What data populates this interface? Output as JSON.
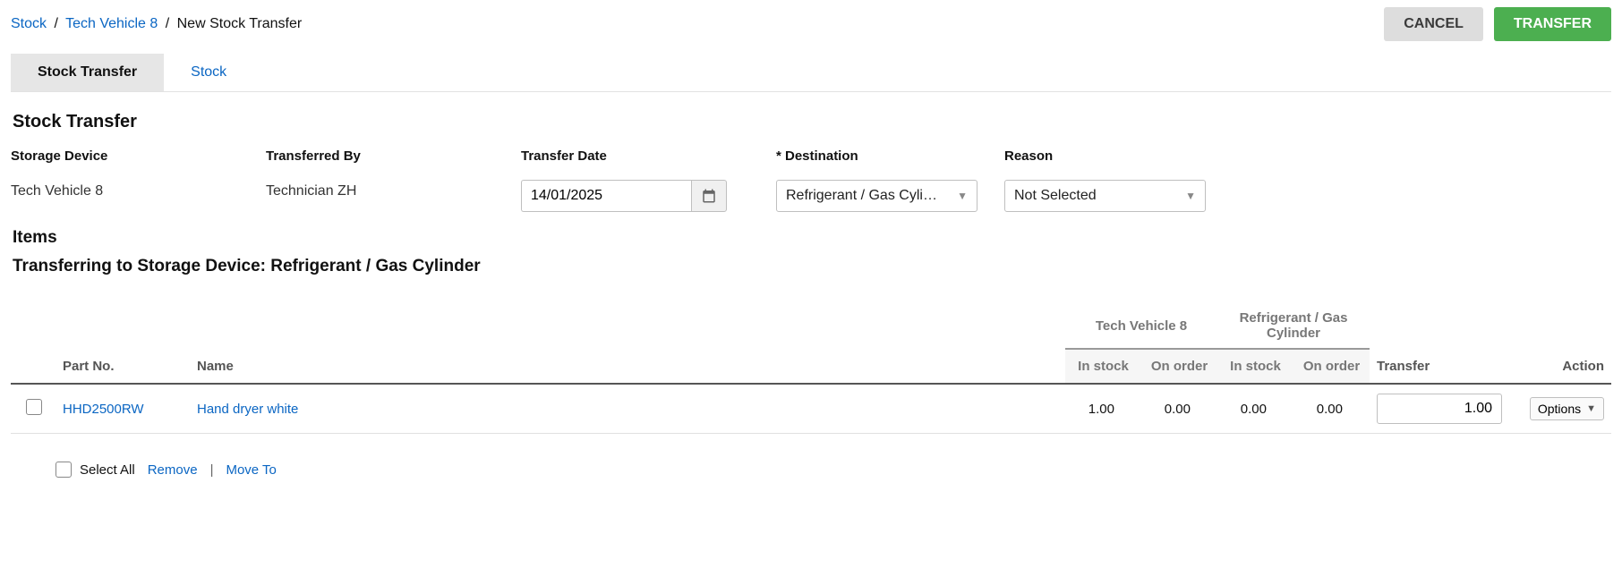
{
  "breadcrumb": {
    "root": "Stock",
    "device": "Tech Vehicle 8",
    "current": "New Stock Transfer"
  },
  "buttons": {
    "cancel": "CANCEL",
    "transfer": "TRANSFER"
  },
  "tabs": {
    "stock_transfer": "Stock Transfer",
    "stock": "Stock"
  },
  "section": {
    "title": "Stock Transfer",
    "labels": {
      "storage_device": "Storage Device",
      "transferred_by": "Transferred By",
      "transfer_date": "Transfer Date",
      "destination": "* Destination",
      "reason": "Reason"
    },
    "values": {
      "storage_device": "Tech Vehicle 8",
      "transferred_by": "Technician ZH",
      "transfer_date": "14/01/2025",
      "destination": "Refrigerant / Gas Cylind…",
      "reason": "Not Selected"
    }
  },
  "items_section": {
    "title": "Items",
    "transfer_heading": "Transferring to Storage Device: Refrigerant / Gas Cylinder",
    "group_headers": {
      "source": "Tech Vehicle 8",
      "dest": "Refrigerant / Gas Cylinder"
    },
    "col_headers": {
      "part_no": "Part No.",
      "name": "Name",
      "in_stock": "In stock",
      "on_order": "On order",
      "transfer": "Transfer",
      "action": "Action"
    },
    "rows": [
      {
        "part_no": "HHD2500RW",
        "name": "Hand dryer white",
        "src_in_stock": "1.00",
        "src_on_order": "0.00",
        "dest_in_stock": "0.00",
        "dest_on_order": "0.00",
        "transfer_qty": "1.00",
        "action_label": "Options"
      }
    ]
  },
  "footer": {
    "select_all": "Select All",
    "remove": "Remove",
    "move_to": "Move To"
  }
}
